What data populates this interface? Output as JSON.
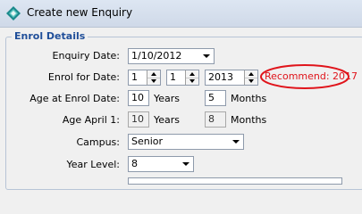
{
  "window": {
    "title": "Create new Enquiry"
  },
  "group": {
    "title": "Enrol Details"
  },
  "fields": {
    "enquiry_date": {
      "label": "Enquiry Date:",
      "value": "1/10/2012"
    },
    "enrol_for_date": {
      "label": "Enrol for Date:",
      "day": "1",
      "month": "1",
      "year": "2013"
    },
    "recommend": {
      "text": "Recommend: 2017",
      "color": "#e0141b"
    },
    "age_at_enrol": {
      "label": "Age at Enrol Date:",
      "years": "10",
      "years_unit": "Years",
      "months": "5",
      "months_unit": "Months"
    },
    "age_april": {
      "label": "Age April 1:",
      "years": "10",
      "years_unit": "Years",
      "months": "8",
      "months_unit": "Months"
    },
    "campus": {
      "label": "Campus:",
      "value": "Senior"
    },
    "year_level": {
      "label": "Year Level:",
      "value": "8"
    }
  },
  "icons": {
    "window_icon": "diamond-app-icon"
  }
}
